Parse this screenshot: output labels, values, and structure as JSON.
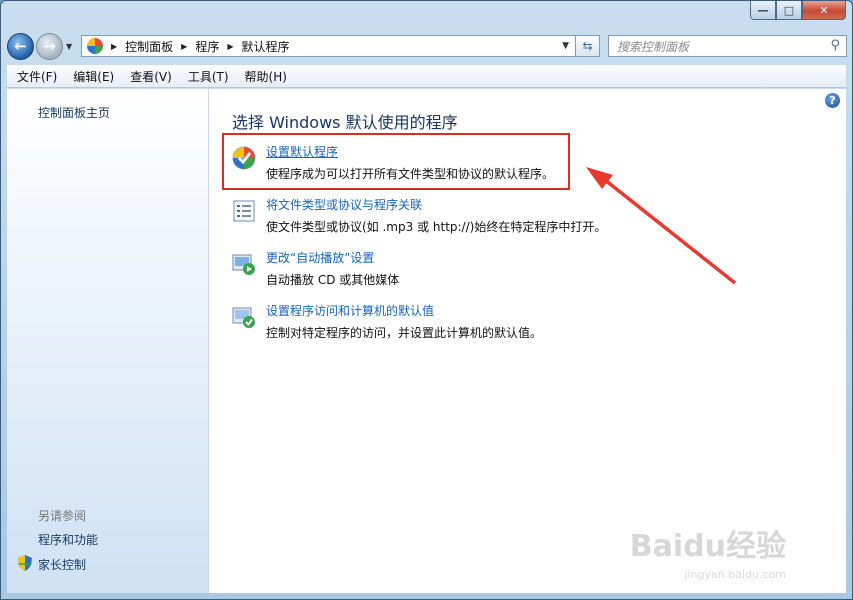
{
  "window": {
    "min_glyph": "—",
    "max_glyph": "□",
    "close_glyph": "✕"
  },
  "address": {
    "crumbs": [
      "控制面板",
      "程序",
      "默认程序"
    ],
    "search_placeholder": "搜索控制面板"
  },
  "menu": [
    "文件(F)",
    "编辑(E)",
    "查看(V)",
    "工具(T)",
    "帮助(H)"
  ],
  "left_pane": {
    "home": "控制面板主页",
    "see_also": "另请参阅",
    "links": [
      "程序和功能",
      "家长控制"
    ]
  },
  "main": {
    "title": "选择 Windows 默认使用的程序",
    "items": [
      {
        "link": "设置默认程序",
        "desc": "使程序成为可以打开所有文件类型和协议的默认程序。",
        "icon": "default-programs-icon"
      },
      {
        "link": "将文件类型或协议与程序关联",
        "desc": "使文件类型或协议(如 .mp3 或 http://)始终在特定程序中打开。",
        "icon": "file-association-icon"
      },
      {
        "link": "更改“自动播放”设置",
        "desc": "自动播放 CD 或其他媒体",
        "icon": "autoplay-icon"
      },
      {
        "link": "设置程序访问和计算机的默认值",
        "desc": "控制对特定程序的访问，并设置此计算机的默认值。",
        "icon": "program-access-icon"
      }
    ]
  },
  "watermark": {
    "brand": "Baidu经验",
    "site": "jingyan.baidu.com"
  },
  "colors": {
    "link": "#1563c0",
    "highlight": "#e02a2a",
    "title": "#1a3668"
  }
}
